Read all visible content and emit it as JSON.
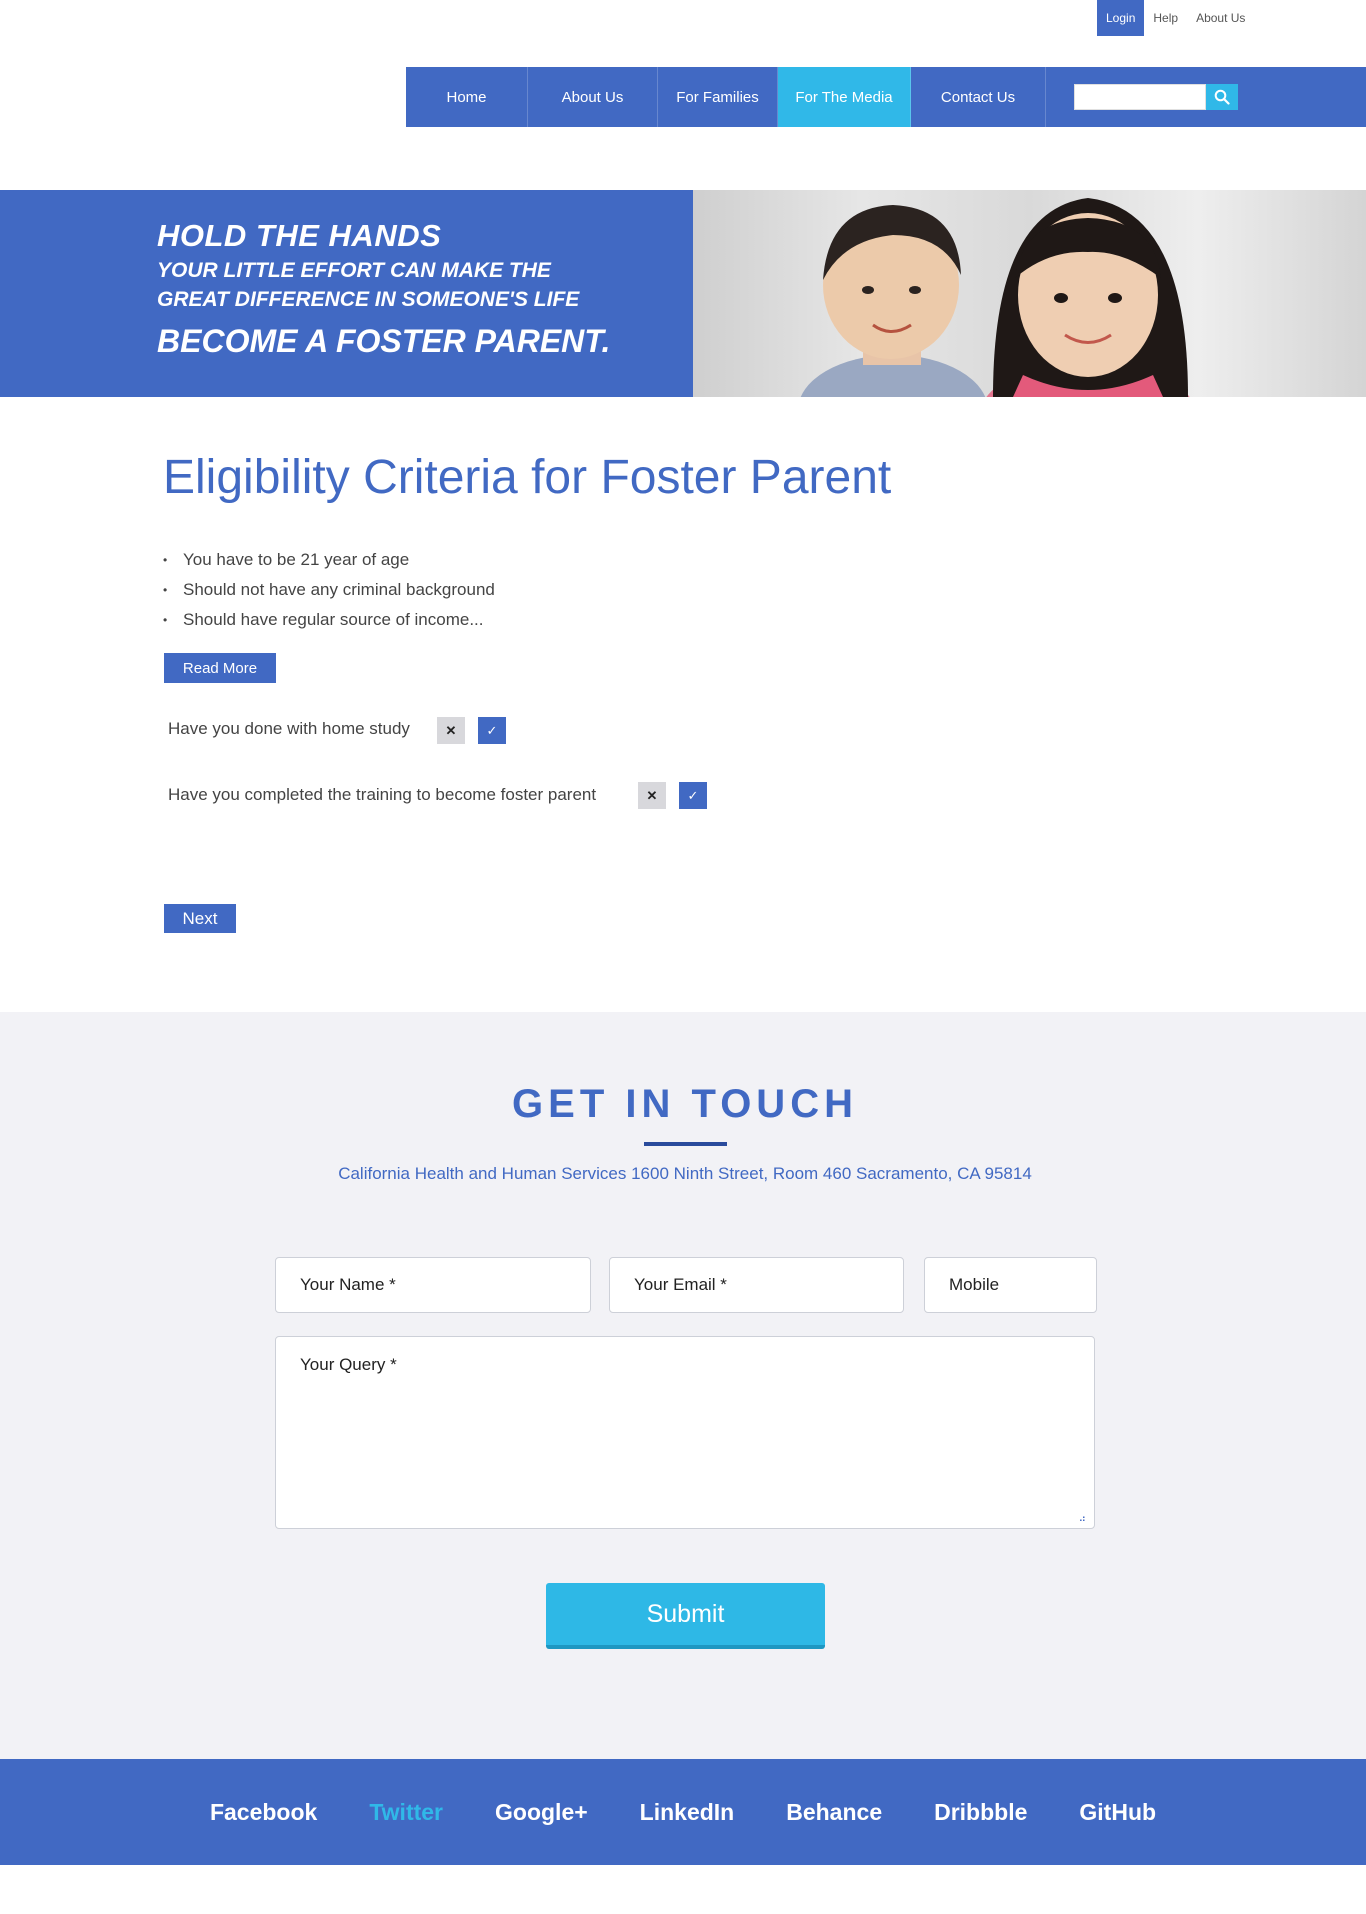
{
  "util_bar": {
    "login": "Login",
    "help": "Help",
    "about": "About Us"
  },
  "nav": {
    "items": [
      {
        "label": "Home"
      },
      {
        "label": "About Us"
      },
      {
        "label": "For Families"
      },
      {
        "label": "For The Media"
      },
      {
        "label": "Contact Us"
      }
    ],
    "active_index": 3,
    "search": {
      "placeholder": "",
      "value": ""
    }
  },
  "banner": {
    "line1": "HOLD THE HANDS",
    "line2": "YOUR LITTLE EFFORT CAN MAKE THE",
    "line3": "GREAT DIFFERENCE IN SOMEONE'S LIFE",
    "line4": "BECOME A FOSTER PARENT."
  },
  "eligibility": {
    "title": "Eligibility Criteria for Foster Parent",
    "bullets": [
      "You have to be 21  year of age",
      "Should not have any criminal background",
      "Should have regular source of income..."
    ],
    "read_more": "Read More",
    "questions": [
      {
        "text": "Have you done with home study"
      },
      {
        "text": "Have you completed the training to  become foster parent"
      }
    ],
    "next": "Next"
  },
  "contact": {
    "heading": "GET IN TOUCH",
    "address": "California Health and Human Services 1600 Ninth Street, Room 460 Sacramento, CA 95814",
    "fields": {
      "name": "Your Name *",
      "email": "Your Email *",
      "mobile": "Mobile",
      "query": "Your Query *"
    },
    "submit": "Submit"
  },
  "footer": {
    "links": [
      "Facebook",
      "Twitter",
      "Google+",
      "LinkedIn",
      "Behance",
      "Dribbble",
      "GitHub"
    ],
    "active_index": 1
  },
  "colors": {
    "primary": "#4169c3",
    "accent": "#30b8e8",
    "section_bg": "#f2f2f6"
  }
}
